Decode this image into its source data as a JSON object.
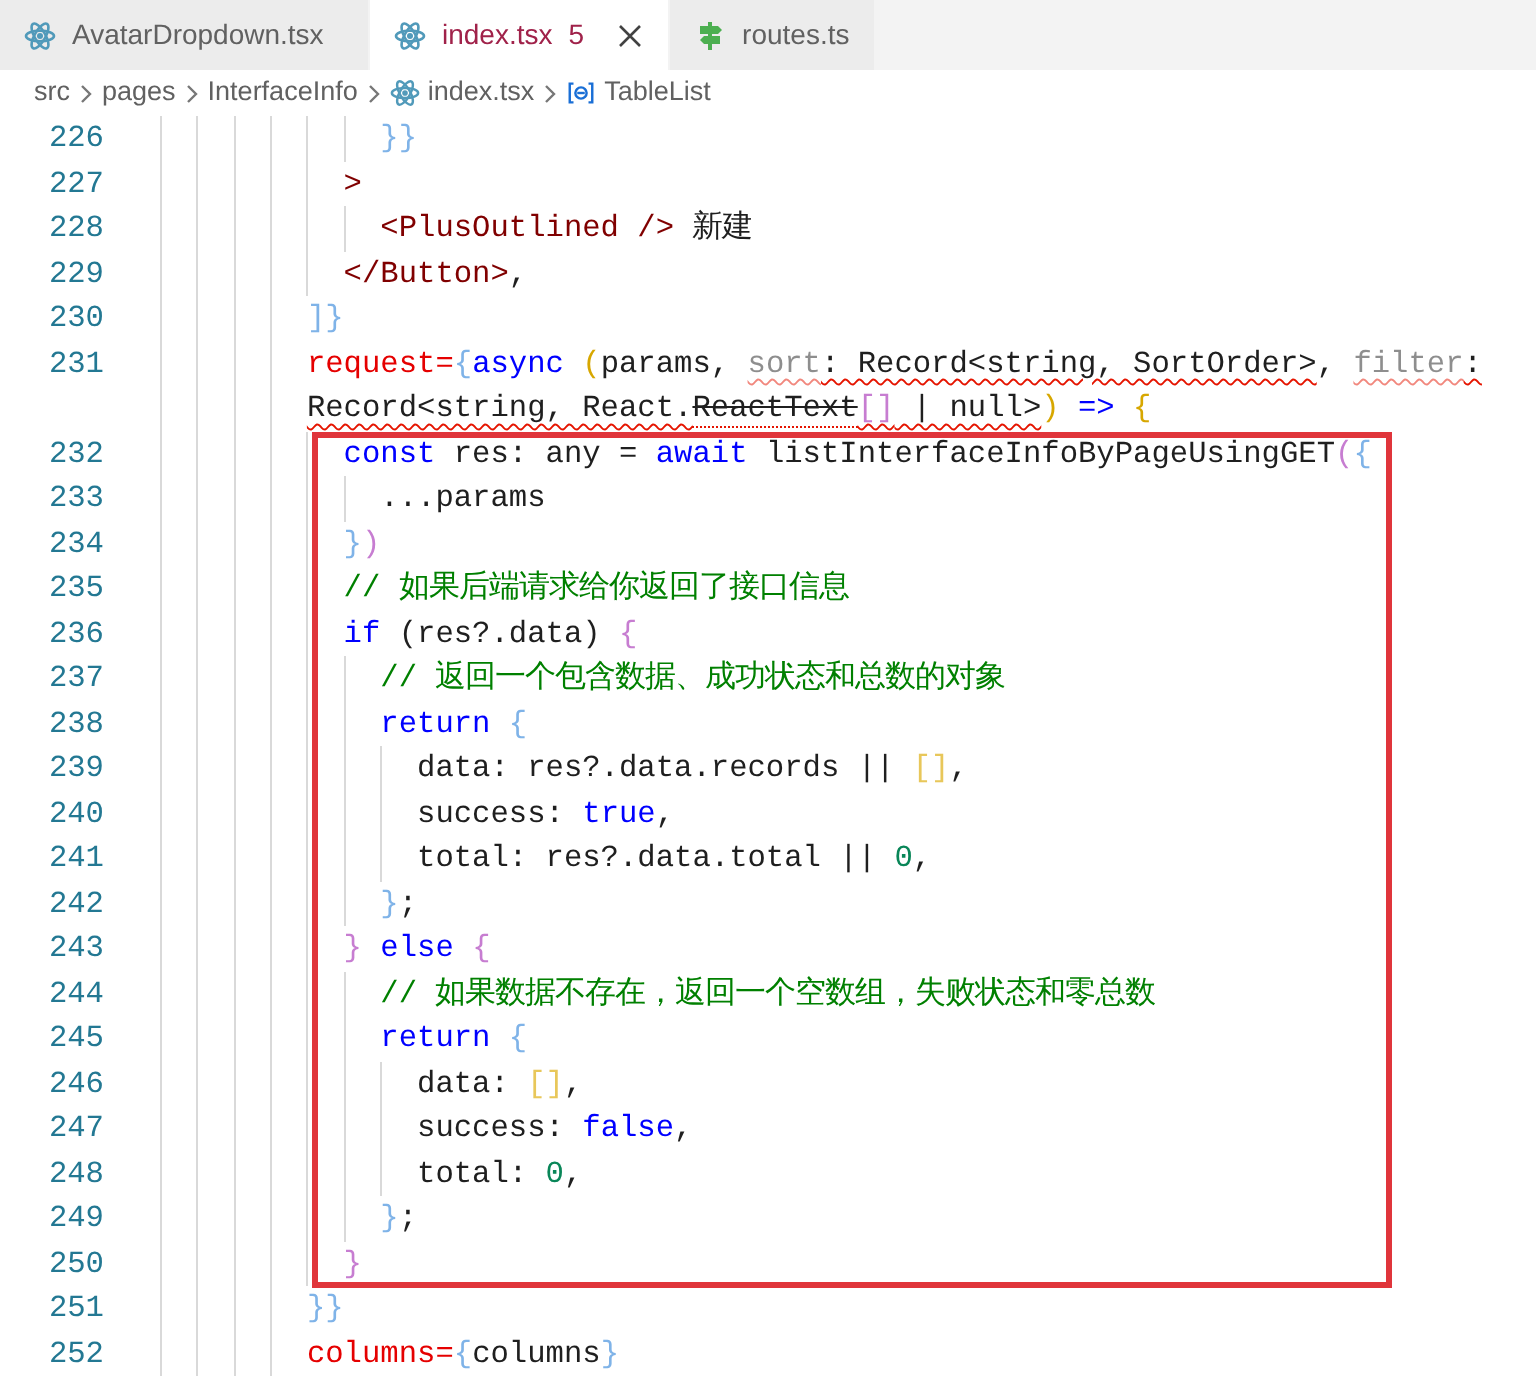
{
  "tabs": [
    {
      "label": "AvatarDropdown.tsx",
      "kind": "component",
      "selected": false,
      "has_errors": false
    },
    {
      "label": "index.tsx",
      "kind": "component",
      "selected": true,
      "has_errors": true,
      "problems": "5"
    },
    {
      "label": "routes.ts",
      "kind": "module",
      "selected": false,
      "has_errors": false
    }
  ],
  "breadcrumb": [
    {
      "label": "src",
      "kind": "folder"
    },
    {
      "label": "pages",
      "kind": "folder"
    },
    {
      "label": "InterfaceInfo",
      "kind": "folder"
    },
    {
      "label": "index.tsx",
      "kind": "file"
    },
    {
      "label": "TableList",
      "kind": "symbol"
    }
  ],
  "lines": [
    {
      "children": [
        {
          "children": [
            {
              "number": "226",
              "tokens": [
                {
                  "t": "}}",
                  "kind": "bracket",
                  "color": "#7fb3e8"
                }
              ]
            }
          ]
        },
        {
          "number": "227",
          "tokens": [
            {
              "t": ">",
              "kind": "tag"
            }
          ],
          "children": [
            {
              "number": "228",
              "tokens": [
                {
                  "t": "<PlusOutlined />",
                  "kind": "tag"
                },
                {
                  "t": " 新建",
                  "kind": "plain"
                }
              ]
            }
          ]
        },
        {
          "number": "229",
          "tokens": [
            {
              "t": "</Button>",
              "kind": "tag"
            },
            {
              "t": ",",
              "kind": "plain"
            }
          ]
        }
      ]
    },
    {
      "number": "230",
      "tokens": [
        {
          "t": "]}",
          "kind": "bracket",
          "color": "#7fb3e8"
        }
      ]
    },
    {
      "number": "231",
      "children_boxed": true,
      "tokens": [
        {
          "t": "request=",
          "kind": "attr"
        },
        {
          "t": "{",
          "kind": "bracket",
          "color": "#7fb3e8"
        },
        {
          "t": "async ",
          "kind": "kw"
        },
        {
          "t": "(",
          "kind": "bracket",
          "color": "#d7a700"
        },
        {
          "t": "params, ",
          "kind": "plain"
        },
        {
          "t": "sort",
          "kind": "plain",
          "faded": true,
          "squiggle": true
        },
        {
          "t": ": Record<string, SortOrder>",
          "kind": "plain",
          "squiggle": true
        },
        {
          "t": ", ",
          "kind": "plain"
        },
        {
          "t": "filter",
          "kind": "plain",
          "faded": true,
          "squiggle": true
        },
        {
          "t": ":",
          "kind": "plain",
          "squiggle": true
        }
      ],
      "wrapped": [
        {
          "t": "Record<string, React.",
          "kind": "plain",
          "squiggle": true
        },
        {
          "t": "ReactText",
          "kind": "plain",
          "strike": true,
          "squiggle": true
        },
        {
          "t": "[]",
          "kind": "bracket",
          "color": "#c77dd1",
          "squiggle": true
        },
        {
          "t": " | null>",
          "kind": "plain",
          "squiggle": true
        },
        {
          "t": ")",
          "kind": "bracket",
          "color": "#d7a700"
        },
        {
          "t": " => ",
          "kind": "kw"
        },
        {
          "t": "{",
          "kind": "bracket",
          "color": "#d7a700"
        }
      ],
      "children": [
        {
          "number": "232",
          "tokens": [
            {
              "t": "const",
              "kind": "kw"
            },
            {
              "t": " res: any = ",
              "kind": "plain"
            },
            {
              "t": "await",
              "kind": "kw"
            },
            {
              "t": " listInterfaceInfoByPageUsingGET",
              "kind": "plain"
            },
            {
              "t": "(",
              "kind": "bracket",
              "color": "#c77dd1"
            },
            {
              "t": "{",
              "kind": "bracket",
              "color": "#7fb3e8"
            }
          ],
          "children": [
            {
              "number": "233",
              "tokens": [
                {
                  "t": "...params",
                  "kind": "plain"
                }
              ]
            }
          ]
        },
        {
          "number": "234",
          "tokens": [
            {
              "t": "}",
              "kind": "bracket",
              "color": "#7fb3e8"
            },
            {
              "t": ")",
              "kind": "bracket",
              "color": "#c77dd1"
            }
          ]
        },
        {
          "number": "235",
          "tokens": [
            {
              "t": "// 如果后端请求给你返回了接口信息",
              "kind": "comment"
            }
          ]
        },
        {
          "number": "236",
          "tokens": [
            {
              "t": "if",
              "kind": "kw"
            },
            {
              "t": " (res?.data) ",
              "kind": "plain"
            },
            {
              "t": "{",
              "kind": "bracket",
              "color": "#c77dd1"
            }
          ],
          "children": [
            {
              "number": "237",
              "tokens": [
                {
                  "t": "// 返回一个包含数据、成功状态和总数的对象",
                  "kind": "comment"
                }
              ]
            },
            {
              "number": "238",
              "tokens": [
                {
                  "t": "return ",
                  "kind": "kw"
                },
                {
                  "t": "{",
                  "kind": "bracket",
                  "color": "#7fb3e8"
                }
              ],
              "children": [
                {
                  "number": "239",
                  "tokens": [
                    {
                      "t": "data: res?.data.records || ",
                      "kind": "plain"
                    },
                    {
                      "t": "[]",
                      "kind": "bracket",
                      "color": "#e8c75a"
                    },
                    {
                      "t": ",",
                      "kind": "plain"
                    }
                  ]
                },
                {
                  "number": "240",
                  "tokens": [
                    {
                      "t": "success: ",
                      "kind": "plain"
                    },
                    {
                      "t": "true",
                      "kind": "kw"
                    },
                    {
                      "t": ",",
                      "kind": "plain"
                    }
                  ]
                },
                {
                  "number": "241",
                  "tokens": [
                    {
                      "t": "total: res?.data.total || ",
                      "kind": "plain"
                    },
                    {
                      "t": "0",
                      "kind": "num"
                    },
                    {
                      "t": ",",
                      "kind": "plain"
                    }
                  ]
                }
              ]
            },
            {
              "number": "242",
              "tokens": [
                {
                  "t": "}",
                  "kind": "bracket",
                  "color": "#7fb3e8"
                },
                {
                  "t": ";",
                  "kind": "plain"
                }
              ]
            }
          ]
        },
        {
          "number": "243",
          "tokens": [
            {
              "t": "}",
              "kind": "bracket",
              "color": "#c77dd1"
            },
            {
              "t": " else ",
              "kind": "kw"
            },
            {
              "t": "{",
              "kind": "bracket",
              "color": "#c77dd1"
            }
          ],
          "children": [
            {
              "number": "244",
              "tokens": [
                {
                  "t": "// 如果数据不存在，返回一个空数组，失败状态和零总数",
                  "kind": "comment"
                }
              ]
            },
            {
              "number": "245",
              "tokens": [
                {
                  "t": "return ",
                  "kind": "kw"
                },
                {
                  "t": "{",
                  "kind": "bracket",
                  "color": "#7fb3e8"
                }
              ],
              "children": [
                {
                  "number": "246",
                  "tokens": [
                    {
                      "t": "data: ",
                      "kind": "plain"
                    },
                    {
                      "t": "[]",
                      "kind": "bracket",
                      "color": "#e8c75a"
                    },
                    {
                      "t": ",",
                      "kind": "plain"
                    }
                  ]
                },
                {
                  "number": "247",
                  "tokens": [
                    {
                      "t": "success: ",
                      "kind": "plain"
                    },
                    {
                      "t": "false",
                      "kind": "kw"
                    },
                    {
                      "t": ",",
                      "kind": "plain"
                    }
                  ]
                },
                {
                  "number": "248",
                  "tokens": [
                    {
                      "t": "total: ",
                      "kind": "plain"
                    },
                    {
                      "t": "0",
                      "kind": "num"
                    },
                    {
                      "t": ",",
                      "kind": "plain"
                    }
                  ]
                }
              ]
            },
            {
              "number": "249",
              "tokens": [
                {
                  "t": "}",
                  "kind": "bracket",
                  "color": "#7fb3e8"
                },
                {
                  "t": ";",
                  "kind": "plain"
                }
              ]
            }
          ]
        },
        {
          "number": "250",
          "tokens": [
            {
              "t": "}",
              "kind": "bracket",
              "color": "#c77dd1"
            }
          ]
        }
      ]
    },
    {
      "number": "251",
      "tokens": [
        {
          "t": "}}",
          "kind": "bracket",
          "color": "#7fb3e8"
        }
      ]
    },
    {
      "number": "252",
      "tokens": [
        {
          "t": "columns=",
          "kind": "attr"
        },
        {
          "t": "{",
          "kind": "bracket",
          "color": "#7fb3e8"
        },
        {
          "t": "columns",
          "kind": "plain"
        },
        {
          "t": "}",
          "kind": "bracket",
          "color": "#7fb3e8"
        }
      ]
    }
  ]
}
